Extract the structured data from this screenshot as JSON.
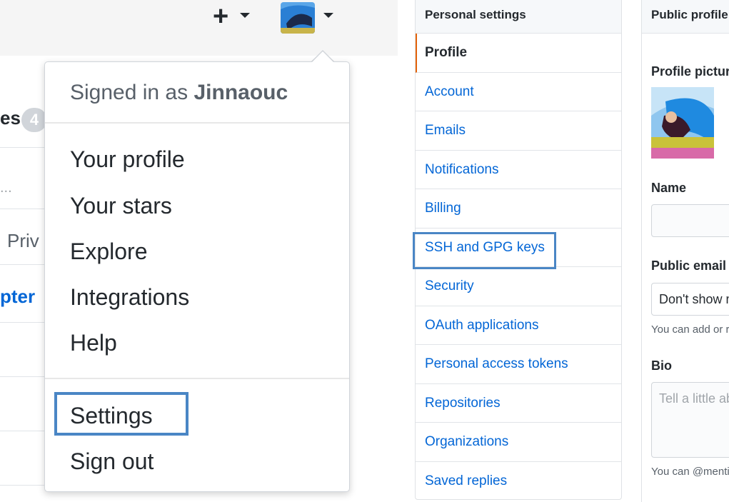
{
  "header": {
    "plus_label": "+",
    "accent_color": "#4a86c5"
  },
  "background": {
    "tab_fragment": "es",
    "badge_fragment": "4",
    "search_fragment": "...",
    "privacy_fragment": "Priv",
    "repo_fragment": "pter"
  },
  "dropdown": {
    "signed_in_prefix": "Signed in as",
    "username": "Jinnaouc",
    "items": [
      "Your profile",
      "Your stars",
      "Explore",
      "Integrations",
      "Help"
    ],
    "settings_label": "Settings",
    "signout_label": "Sign out"
  },
  "settings_nav": {
    "title": "Personal settings",
    "items": [
      "Profile",
      "Account",
      "Emails",
      "Notifications",
      "Billing",
      "SSH and GPG keys",
      "Security",
      "OAuth applications",
      "Personal access tokens",
      "Repositories",
      "Organizations",
      "Saved replies"
    ],
    "selected": "Profile"
  },
  "profile": {
    "title": "Public profile",
    "picture_label": "Profile picture",
    "name_label": "Name",
    "name_value": "",
    "email_label": "Public email",
    "email_value": "Don't show my email address",
    "email_note": "You can add or remove verified email addresses in your personal email settings.",
    "bio_label": "Bio",
    "bio_placeholder": "Tell a little about yourself",
    "bio_note": "You can @mention other users and organizations to link to them."
  }
}
